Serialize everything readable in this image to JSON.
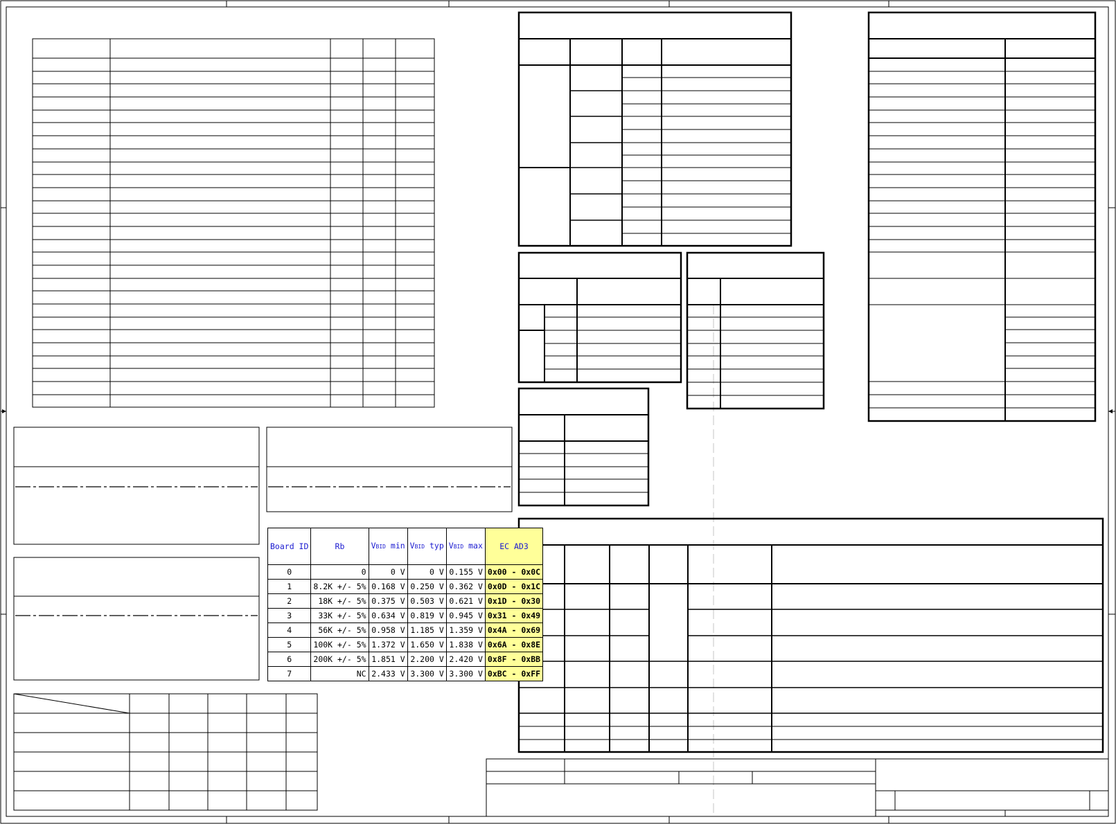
{
  "board_id_table": {
    "headers": {
      "board_id": "Board ID",
      "rb": "Rb",
      "vmin": "min",
      "vtyp": "typ",
      "vmax": "max",
      "ec": "EC AD3",
      "v_prefix": "V",
      "v_subscript": "BID"
    },
    "rows": [
      {
        "id": "0",
        "rb": "0",
        "vmin": "0 V",
        "vtyp": "0 V",
        "vmax": "0.155 V",
        "ec": "0x00 - 0x0C"
      },
      {
        "id": "1",
        "rb": "8.2K +/- 5%",
        "vmin": "0.168 V",
        "vtyp": "0.250 V",
        "vmax": "0.362 V",
        "ec": "0x0D - 0x1C"
      },
      {
        "id": "2",
        "rb": "18K +/- 5%",
        "vmin": "0.375 V",
        "vtyp": "0.503 V",
        "vmax": "0.621 V",
        "ec": "0x1D - 0x30"
      },
      {
        "id": "3",
        "rb": "33K +/- 5%",
        "vmin": "0.634 V",
        "vtyp": "0.819 V",
        "vmax": "0.945 V",
        "ec": "0x31 - 0x49"
      },
      {
        "id": "4",
        "rb": "56K +/- 5%",
        "vmin": "0.958 V",
        "vtyp": "1.185 V",
        "vmax": "1.359 V",
        "ec": "0x4A - 0x69"
      },
      {
        "id": "5",
        "rb": "100K +/- 5%",
        "vmin": "1.372 V",
        "vtyp": "1.650 V",
        "vmax": "1.838 V",
        "ec": "0x6A - 0x8E"
      },
      {
        "id": "6",
        "rb": "200K +/- 5%",
        "vmin": "1.851 V",
        "vtyp": "2.200 V",
        "vmax": "2.420 V",
        "ec": "0x8F - 0xBB"
      },
      {
        "id": "7",
        "rb": "NC",
        "vmin": "2.433 V",
        "vtyp": "3.300 V",
        "vmax": "3.300 V",
        "ec": "0xBC - 0xFF"
      }
    ]
  },
  "colors": {
    "line": "#000000",
    "header_text": "#1a1ad0",
    "highlight": "#ffff99",
    "dash_guide": "#d8d8d8"
  }
}
